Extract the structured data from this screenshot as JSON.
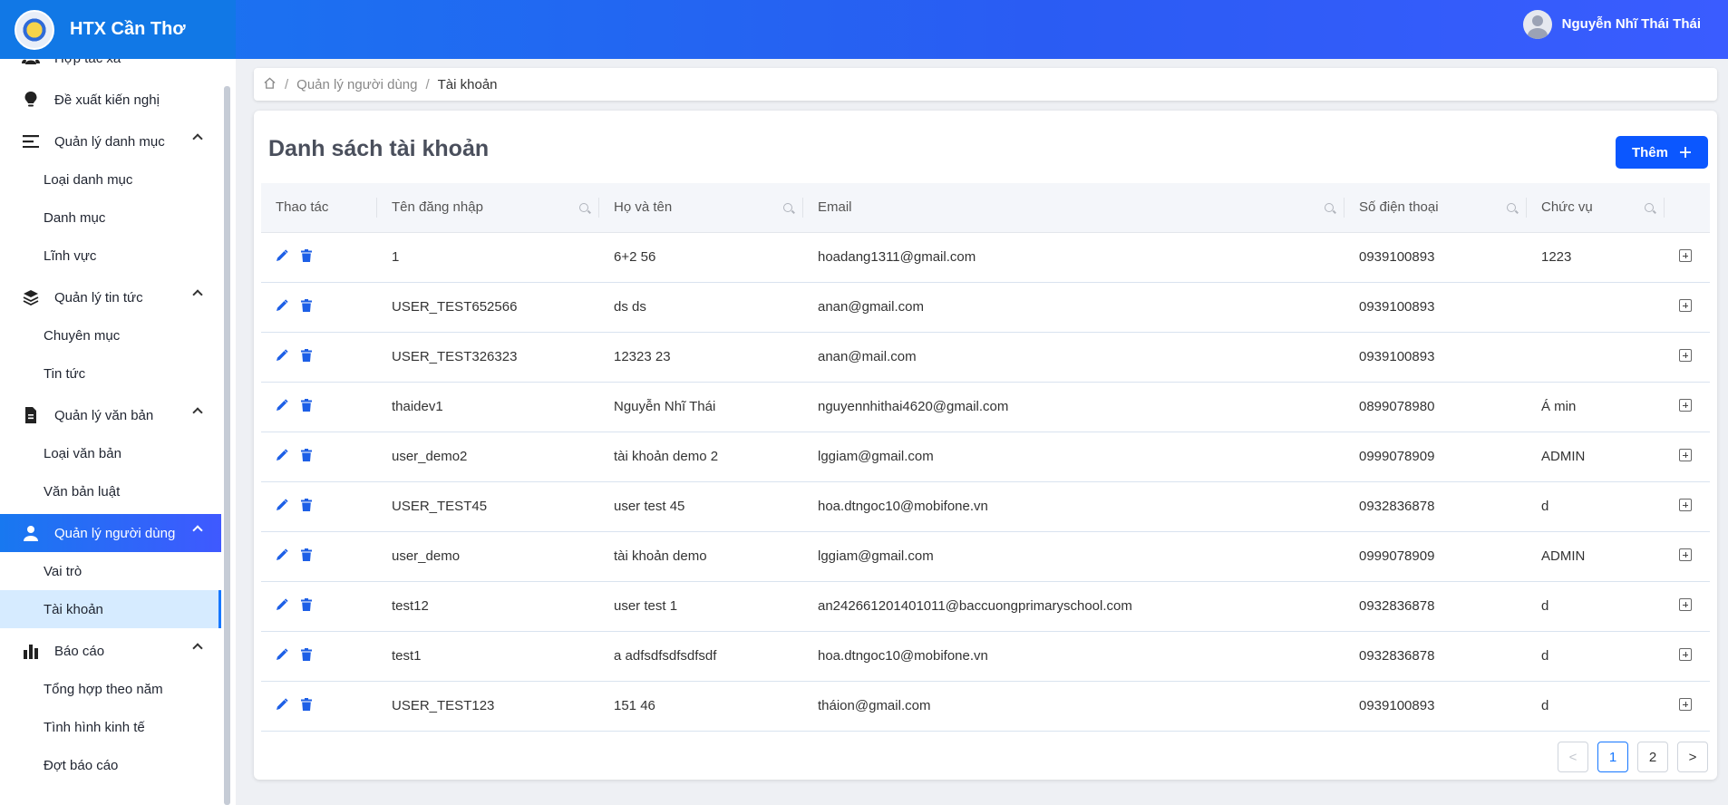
{
  "brand": {
    "title": "HTX Cần Thơ"
  },
  "user": {
    "name": "Nguyễn Nhĩ Thái Thái"
  },
  "colors": {
    "primary": "#0b57ff",
    "header_start": "#1777f0",
    "header_end": "#3a5cff",
    "selected_bg": "#d6ebff"
  },
  "sidebar": {
    "items": [
      {
        "label": "Hợp tác xã",
        "type": "group",
        "icon": "users-icon"
      },
      {
        "label": "Đề xuất kiến nghị",
        "type": "group",
        "icon": "lightbulb-icon"
      },
      {
        "label": "Quản lý danh mục",
        "type": "group",
        "icon": "menu-icon",
        "expanded": true
      },
      {
        "label": "Loại danh mục",
        "type": "sub"
      },
      {
        "label": "Danh mục",
        "type": "sub"
      },
      {
        "label": "Lĩnh vực",
        "type": "sub"
      },
      {
        "label": "Quản lý tin tức",
        "type": "group",
        "icon": "layers-icon",
        "expanded": true
      },
      {
        "label": "Chuyên mục",
        "type": "sub"
      },
      {
        "label": "Tin tức",
        "type": "sub"
      },
      {
        "label": "Quản lý văn bản",
        "type": "group",
        "icon": "file-icon",
        "expanded": true
      },
      {
        "label": "Loại văn bản",
        "type": "sub"
      },
      {
        "label": "Văn bản luật",
        "type": "sub"
      },
      {
        "label": "Quản lý người dùng",
        "type": "group",
        "icon": "user-icon",
        "expanded": true,
        "active": true
      },
      {
        "label": "Vai trò",
        "type": "sub"
      },
      {
        "label": "Tài khoản",
        "type": "sub",
        "selected": true
      },
      {
        "label": "Báo cáo",
        "type": "group",
        "icon": "bar-chart-icon",
        "expanded": true
      },
      {
        "label": "Tổng hợp theo năm",
        "type": "sub"
      },
      {
        "label": "Tình hình kinh tế",
        "type": "sub"
      },
      {
        "label": "Đợt báo cáo",
        "type": "sub"
      }
    ]
  },
  "breadcrumb": {
    "home_icon": "home-icon",
    "parent": "Quản lý người dùng",
    "current": "Tài khoản",
    "separator": "/"
  },
  "main": {
    "title": "Danh sách tài khoản",
    "add_label": "Thêm",
    "columns": [
      "Thao tác",
      "Tên đăng nhập",
      "Họ và tên",
      "Email",
      "Số điện thoại",
      "Chức vụ"
    ],
    "rows": [
      {
        "username": "1",
        "fullname": "6+2 56",
        "email": "hoadang1311@gmail.com",
        "phone": "0939100893",
        "position": "1223"
      },
      {
        "username": "USER_TEST652566",
        "fullname": "ds ds",
        "email": "anan@gmail.com",
        "phone": "0939100893",
        "position": ""
      },
      {
        "username": "USER_TEST326323",
        "fullname": "12323 23",
        "email": "anan@mail.com",
        "phone": "0939100893",
        "position": ""
      },
      {
        "username": "thaidev1",
        "fullname": "Nguyễn Nhĩ Thái",
        "email": "nguyennhithai4620@gmail.com",
        "phone": "0899078980",
        "position": "Á min"
      },
      {
        "username": "user_demo2",
        "fullname": "tài khoản demo 2",
        "email": "lggiam@gmail.com",
        "phone": "0999078909",
        "position": "ADMIN"
      },
      {
        "username": "USER_TEST45",
        "fullname": "user test 45",
        "email": "hoa.dtngoc10@mobifone.vn",
        "phone": "0932836878",
        "position": "d"
      },
      {
        "username": "user_demo",
        "fullname": "tài khoản demo",
        "email": "lggiam@gmail.com",
        "phone": "0999078909",
        "position": "ADMIN"
      },
      {
        "username": "test12",
        "fullname": "user test 1",
        "email": "an242661201401011@baccuongprimaryschool.com",
        "phone": "0932836878",
        "position": "d"
      },
      {
        "username": "test1",
        "fullname": "a adfsdfsdfsdfsdf",
        "email": "hoa.dtngoc10@mobifone.vn",
        "phone": "0932836878",
        "position": "d"
      },
      {
        "username": "USER_TEST123",
        "fullname": "151 46",
        "email": "tháion@gmail.com",
        "phone": "0939100893",
        "position": "d"
      }
    ]
  },
  "pagination": {
    "prev": "<",
    "next": ">",
    "pages": [
      "1",
      "2"
    ],
    "current": "1"
  }
}
